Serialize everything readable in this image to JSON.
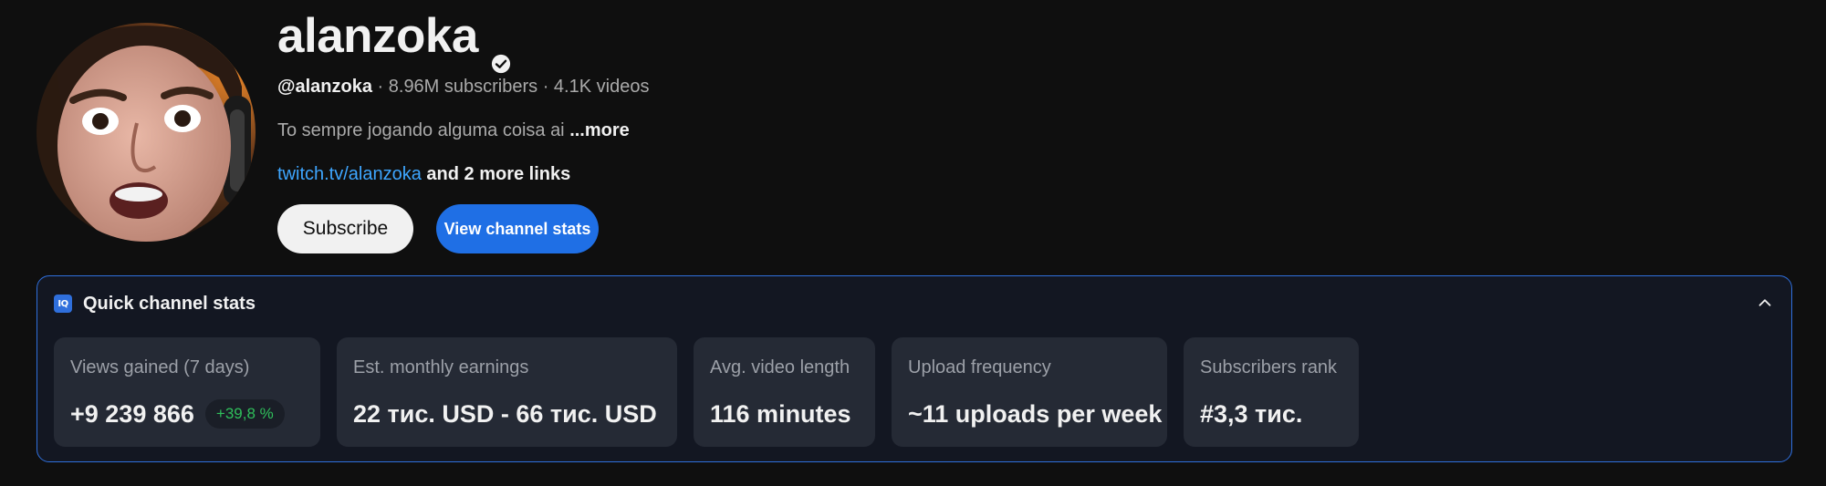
{
  "channel": {
    "name": "alanzoka",
    "handle": "@alanzoka",
    "subscribers": " · 8.96M subscribers",
    "videos": " · 4.1K videos",
    "description": "To sempre jogando alguma coisa ai ",
    "more_label": "...more",
    "link": "twitch.tv/alanzoka",
    "more_links": " and 2 more links"
  },
  "buttons": {
    "subscribe": "Subscribe",
    "view_stats": "View channel stats"
  },
  "quick_stats": {
    "icon_text": "IQ",
    "title": "Quick channel stats",
    "cards": [
      {
        "label": "Views gained (7 days)",
        "value": "+9 239 866",
        "badge": "+39,8 %"
      },
      {
        "label": "Est. monthly earnings",
        "value": "22 тис. USD - 66 тис. USD"
      },
      {
        "label": "Avg. video length",
        "value": "116 minutes"
      },
      {
        "label": "Upload frequency",
        "value": "~11 uploads per week"
      },
      {
        "label": "Subscribers rank",
        "value": "#3,3 тис."
      }
    ]
  },
  "colors": {
    "background": "#0f0f0f",
    "accent_blue": "#1f6fe5",
    "link_blue": "#3ea6ff",
    "badge_green": "#2fbf5b",
    "card_bg": "#252a35"
  }
}
